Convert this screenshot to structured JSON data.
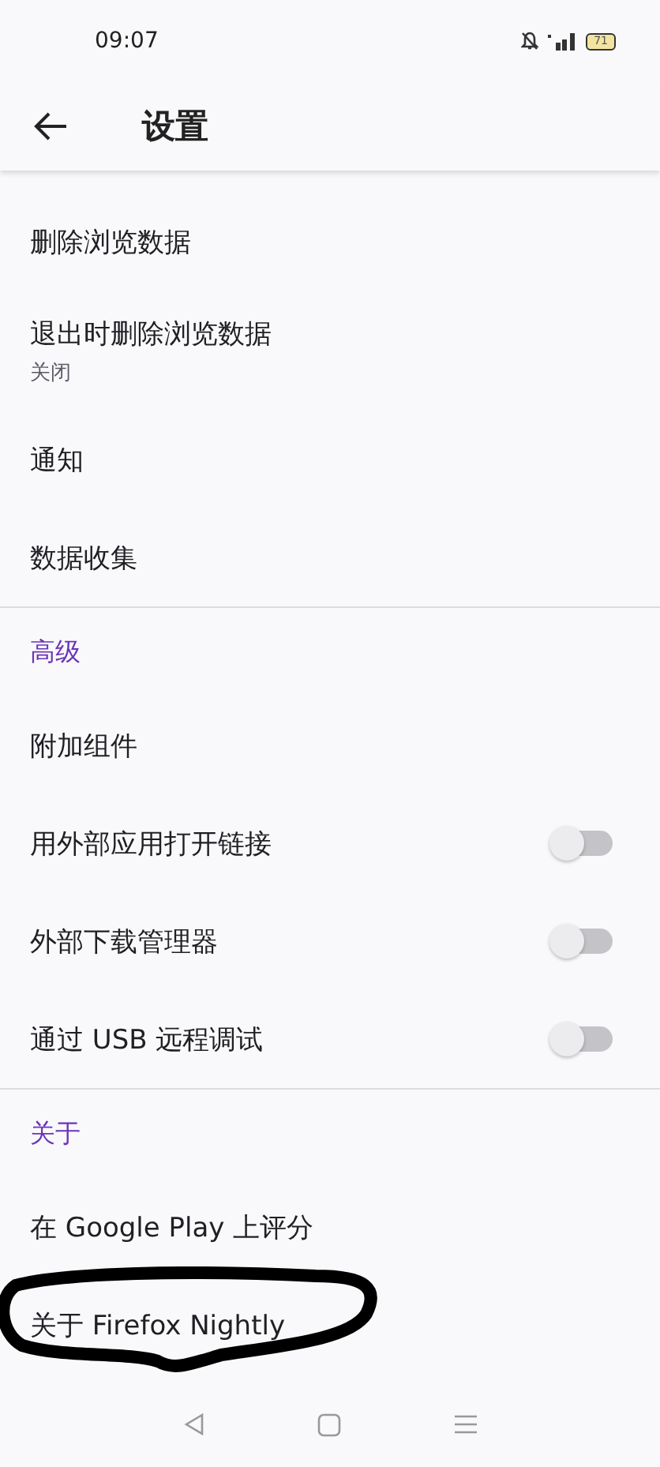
{
  "status_bar": {
    "time": "09:07",
    "battery": "71"
  },
  "header": {
    "title": "设置"
  },
  "sections": [
    {
      "items": [
        {
          "kind": "plain",
          "label": "删除浏览数据"
        },
        {
          "kind": "plain",
          "label": "退出时删除浏览数据",
          "summary": "关闭"
        },
        {
          "kind": "plain",
          "label": "通知"
        },
        {
          "kind": "plain",
          "label": "数据收集"
        }
      ]
    },
    {
      "title": "高级",
      "items": [
        {
          "kind": "plain",
          "label": "附加组件"
        },
        {
          "kind": "switch",
          "label": "用外部应用打开链接",
          "on": false
        },
        {
          "kind": "switch",
          "label": "外部下载管理器",
          "on": false
        },
        {
          "kind": "switch",
          "label": "通过 USB 远程调试",
          "on": false
        }
      ]
    },
    {
      "title": "关于",
      "items": [
        {
          "kind": "plain",
          "label": "在 Google Play 上评分"
        },
        {
          "kind": "plain",
          "label": "关于 Firefox Nightly",
          "circled": true
        }
      ]
    }
  ]
}
